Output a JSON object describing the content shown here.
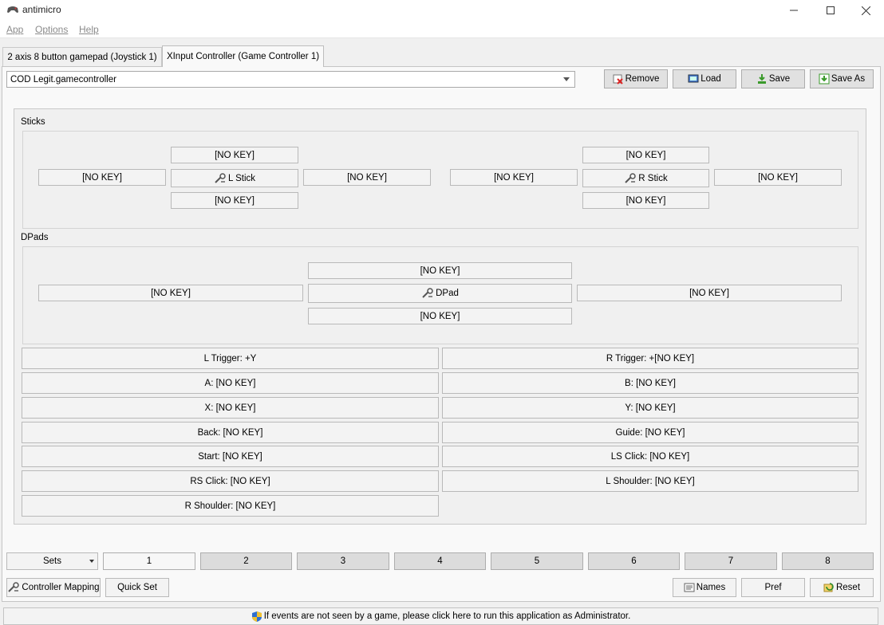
{
  "window": {
    "title": "antimicro",
    "controls": [
      "minimize-icon",
      "maximize-icon",
      "close-icon"
    ]
  },
  "menu": {
    "app": "App",
    "options": "Options",
    "help": "Help"
  },
  "tabs": [
    {
      "label": "2 axis 8 button gamepad (Joystick 1)"
    },
    {
      "label": "XInput Controller (Game Controller 1)"
    }
  ],
  "profile": {
    "selected": "COD Legit.gamecontroller",
    "remove": "Remove",
    "load": "Load",
    "save": "Save",
    "save_as": "Save As"
  },
  "sticks": {
    "label": "Sticks",
    "left": {
      "up": "[NO KEY]",
      "left": "[NO KEY]",
      "center": "L Stick",
      "right": "[NO KEY]",
      "down": "[NO KEY]"
    },
    "right": {
      "up": "[NO KEY]",
      "left": "[NO KEY]",
      "center": "R Stick",
      "right": "[NO KEY]",
      "down": "[NO KEY]"
    }
  },
  "dpads": {
    "label": "DPads",
    "up": "[NO KEY]",
    "left": "[NO KEY]",
    "center": "DPad",
    "right": "[NO KEY]",
    "down": "[NO KEY]"
  },
  "buttons": {
    "l_trigger": "L Trigger: +Y",
    "r_trigger": "R Trigger: +[NO KEY]",
    "a": "A: [NO KEY]",
    "b": "B: [NO KEY]",
    "x": "X: [NO KEY]",
    "y": "Y: [NO KEY]",
    "back": "Back: [NO KEY]",
    "guide": "Guide: [NO KEY]",
    "start": "Start: [NO KEY]",
    "ls_click": "LS Click: [NO KEY]",
    "rs_click": "RS Click: [NO KEY]",
    "l_shoulder": "L Shoulder: [NO KEY]",
    "r_shoulder": "R Shoulder: [NO KEY]"
  },
  "sets": {
    "dropdown": "Sets",
    "numbers": [
      "1",
      "2",
      "3",
      "4",
      "5",
      "6",
      "7",
      "8"
    ],
    "selected": "1"
  },
  "footer": {
    "controller_mapping": "Controller Mapping",
    "quick_set": "Quick Set",
    "names": "Names",
    "pref": "Pref",
    "reset": "Reset"
  },
  "status": {
    "message": "If events are not seen by a game, please click here to run this application as Administrator."
  }
}
